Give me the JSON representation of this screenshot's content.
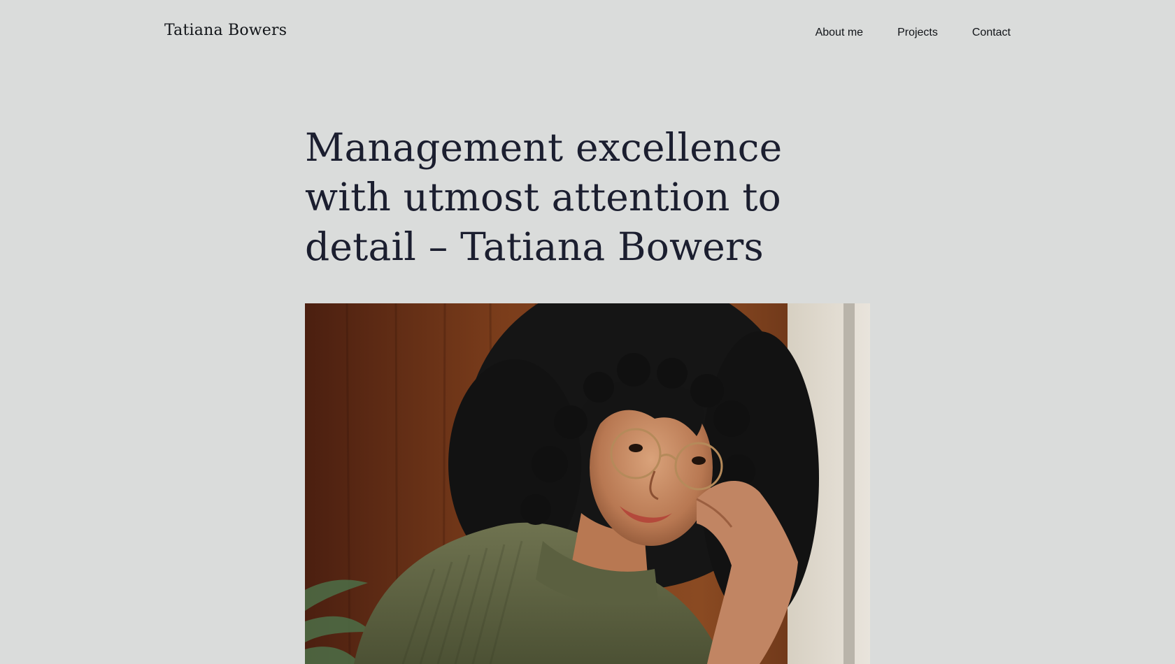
{
  "header": {
    "site_title": "Tatiana Bowers",
    "nav": [
      {
        "label": "About me"
      },
      {
        "label": "Projects"
      },
      {
        "label": "Contact"
      }
    ]
  },
  "hero": {
    "title": "Management excellence with utmost attention to detail – Tatiana Bowers"
  },
  "colors": {
    "background": "#dadcdb",
    "text": "#1b1e2f"
  }
}
